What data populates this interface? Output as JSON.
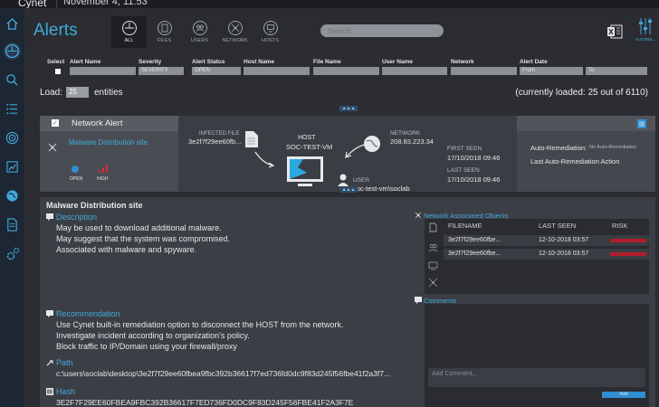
{
  "window": {
    "brand": "Cynet",
    "date": "November 4, 11:53"
  },
  "page": {
    "title": "Alerts"
  },
  "tabs": [
    {
      "label": "ALL",
      "icon": "compass-icon"
    },
    {
      "label": "FILES",
      "icon": "file-icon"
    },
    {
      "label": "USERS",
      "icon": "users-icon"
    },
    {
      "label": "NETWORK",
      "icon": "network-icon"
    },
    {
      "label": "HOSTS",
      "icon": "host-icon"
    }
  ],
  "search": {
    "placeholder": "Search"
  },
  "toolbar": {
    "autosw_label": "AUTORE..."
  },
  "filters": {
    "select_label": "Select",
    "alert_name_label": "Alert Name",
    "severity_label": "Severity",
    "severity_value": "SEVERITY",
    "alert_status_label": "Alert Status",
    "alert_status_value": "OPEN",
    "host_name_label": "Host Name",
    "file_name_label": "File Name",
    "user_name_label": "User Name",
    "network_label": "Network",
    "alert_date_label": "Alert Date",
    "from_placeholder": "From",
    "to_placeholder": "To"
  },
  "load": {
    "label": "Load:",
    "value": "25",
    "entities": "entities",
    "currently_loaded": "(currently loaded: 25 out of 6110)"
  },
  "alert": {
    "type": "Network Alert",
    "name": "Malware Distribution site",
    "status": "OPEN",
    "severity": "HIGH",
    "infected_file_label": "INFECTED FILE",
    "infected_file": "3e2f7f29ee60fb...",
    "host_label": "HOST",
    "host": "SOC-TEST-VM",
    "network_label": "NETWORK",
    "network": "208.83.223.34",
    "user_label": "USER",
    "user": "soc-test-vm\\soclab",
    "first_seen_label": "FIRST SEEN",
    "first_seen": "17/10/2018 09:46",
    "last_seen_label": "LAST SEEN",
    "last_seen": "17/10/2018 09:46",
    "auto_remediation_label": "Auto-Remediation:",
    "auto_remediation_value": "No Auto-Remediation",
    "last_auto_label": "Last Auto-Remediation Action"
  },
  "detail": {
    "title": "Malware Distribution site",
    "description_h": "Description",
    "description": [
      "May be used to download additional malware.",
      "May suggest that the system was compromised.",
      "Associated with malware and spyware."
    ],
    "recommendation_h": "Recommendation",
    "recommendation": [
      "Use Cynet built-in remediation option to disconnect the HOST from the network.",
      "Investigate incident according to organization's policy.",
      "Block traffic to IP/Domain using your firewall/proxy"
    ],
    "path_h": "Path",
    "path": "c:\\users\\soclab\\desktop\\3e2f7f29ee60fbea9fbc392b36617f7ed736fd0dc9f83d245f56fbe41f2a3f7...",
    "hash_h": "Hash",
    "hash": "3E2F7F29EE60FBEA9FBC392B36617F7ED736FD0DC9F83D245F56FBE41F2A3F7E"
  },
  "net_objects": {
    "title": "Network Associated Objects",
    "col_filename": "FILENAME",
    "col_last_seen": "LAST SEEN",
    "col_risk": "RISK",
    "rows": [
      {
        "filename": "3e2f7f29ee60fbe...",
        "last_seen": "12-10-2018 03:57",
        "risk": 1.0
      },
      {
        "filename": "3e2f7f29ee60fbe...",
        "last_seen": "12-10-2018 03:57",
        "risk": 1.0
      }
    ]
  },
  "comments": {
    "title": "Comments",
    "placeholder": "Add Comment...",
    "add_label": "Add"
  },
  "colors": {
    "accent": "#41a9d8",
    "risk": "#b21d2b",
    "severity_high": "#d9293a"
  }
}
